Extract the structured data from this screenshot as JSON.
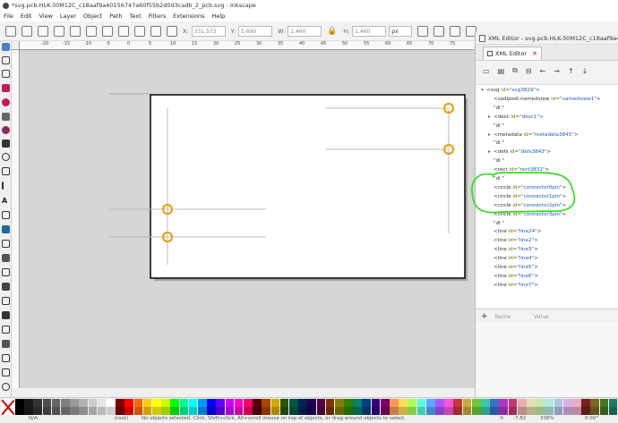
{
  "window": {
    "title": "*svg.pcb.HLK-30M12C_c18aaf9a40156747a60f55b2d0d3cadb_2_pcb.svg - Inkscape"
  },
  "menu": [
    "File",
    "Edit",
    "View",
    "Layer",
    "Object",
    "Path",
    "Text",
    "Filters",
    "Extensions",
    "Help"
  ],
  "tool_controls": {
    "x_label": "X:",
    "x_value": "331.573",
    "y_label": "Y:",
    "y_value": "5.690",
    "w_label": "W:",
    "w_value": "1.460",
    "h_label": "H:",
    "h_value": "1.460",
    "unit": "px"
  },
  "ruler_ticks": [
    "-20",
    "-15",
    "-10",
    "-5",
    "0",
    "5",
    "10",
    "15",
    "20",
    "25",
    "30",
    "35",
    "40",
    "45",
    "50",
    "55",
    "60",
    "65",
    "70",
    "75"
  ],
  "dock": {
    "header": "XML Editor - svg.pcb.HLK-30M12C_c18aaf9a40156747a",
    "tab_label": "XML Editor",
    "toolbar_buttons": [
      "new-element-node",
      "new-text-node",
      "duplicate-node",
      "delete-node",
      "unindent",
      "indent",
      "raise",
      "lower"
    ],
    "tree": [
      {
        "arrow": "▾",
        "prefix": "<",
        "tag": "svg",
        "attr": " id=",
        "val": "\"svg3829\"",
        "suffix": ">"
      },
      {
        "arrow": "",
        "prefix": "<",
        "tag": "sodipodi:namedview",
        "attr": " id=",
        "val": "\"namedview1\"",
        "suffix": ">"
      },
      {
        "arrow": "",
        "prefix": "",
        "tag": "\"dl",
        "attr": "",
        "val": "",
        "suffix": " \""
      },
      {
        "arrow": "▸",
        "prefix": "<",
        "tag": "desc",
        "attr": " id=",
        "val": "\"desc1\"",
        "suffix": ">"
      },
      {
        "arrow": "",
        "prefix": "",
        "tag": "\"dl",
        "attr": "",
        "val": "",
        "suffix": " \""
      },
      {
        "arrow": "▸",
        "prefix": "<",
        "tag": "metadata",
        "attr": " id=",
        "val": "\"metadata3845\"",
        "suffix": ">"
      },
      {
        "arrow": "",
        "prefix": "",
        "tag": "\"dl",
        "attr": "",
        "val": "",
        "suffix": " \""
      },
      {
        "arrow": "▸",
        "prefix": "<",
        "tag": "defs",
        "attr": " id=",
        "val": "\"defs3843\"",
        "suffix": ">"
      },
      {
        "arrow": "",
        "prefix": "",
        "tag": "\"dl",
        "attr": "",
        "val": "",
        "suffix": " \""
      },
      {
        "arrow": "",
        "prefix": "<",
        "tag": "rect",
        "attr": " id=",
        "val": "\"rect3832\"",
        "suffix": ">"
      },
      {
        "arrow": "",
        "prefix": "",
        "tag": "\"dl",
        "attr": "",
        "val": "",
        "suffix": " \""
      },
      {
        "arrow": "",
        "prefix": "<",
        "tag": "circle",
        "attr": " id=",
        "val": "\"connector0pin\"",
        "suffix": ">"
      },
      {
        "arrow": "",
        "prefix": "<",
        "tag": "circle",
        "attr": " id=",
        "val": "\"connector1pin\"",
        "suffix": ">"
      },
      {
        "arrow": "",
        "prefix": "<",
        "tag": "circle",
        "attr": " id=",
        "val": "\"connector2pin\"",
        "suffix": ">"
      },
      {
        "arrow": "",
        "prefix": "<",
        "tag": "circle",
        "attr": " id=",
        "val": "\"connector3pin\"",
        "suffix": ">"
      },
      {
        "arrow": "",
        "prefix": "",
        "tag": "\"dl",
        "attr": "",
        "val": "",
        "suffix": " \""
      },
      {
        "arrow": "",
        "prefix": "<",
        "tag": "line",
        "attr": " id=",
        "val": "\"line24\"",
        "suffix": ">"
      },
      {
        "arrow": "",
        "prefix": "<",
        "tag": "line",
        "attr": " id=",
        "val": "\"line2\"",
        "suffix": ">"
      },
      {
        "arrow": "",
        "prefix": "<",
        "tag": "line",
        "attr": " id=",
        "val": "\"line3\"",
        "suffix": ">"
      },
      {
        "arrow": "",
        "prefix": "<",
        "tag": "line",
        "attr": " id=",
        "val": "\"line4\"",
        "suffix": ">"
      },
      {
        "arrow": "",
        "prefix": "<",
        "tag": "line",
        "attr": " id=",
        "val": "\"line5\"",
        "suffix": ">"
      },
      {
        "arrow": "",
        "prefix": "<",
        "tag": "line",
        "attr": " id=",
        "val": "\"line6\"",
        "suffix": ">"
      },
      {
        "arrow": "",
        "prefix": "<",
        "tag": "line",
        "attr": " id=",
        "val": "\"line7\"",
        "suffix": ">"
      }
    ],
    "attr_headers": {
      "name": "Name",
      "value": "Value"
    }
  },
  "palette_colors": [
    "#000000",
    "#1a1a1a",
    "#333333",
    "#4d4d4d",
    "#666666",
    "#808080",
    "#999999",
    "#b3b3b3",
    "#cccccc",
    "#e6e6e6",
    "#ffffff",
    "#800000",
    "#ff0000",
    "#ff6600",
    "#ffcc00",
    "#ffff00",
    "#ccff00",
    "#00ff00",
    "#00ff99",
    "#00ffff",
    "#0099ff",
    "#0000ff",
    "#6600ff",
    "#cc00ff",
    "#ff00cc",
    "#ff0066",
    "#550000",
    "#aa4400",
    "#d4aa00",
    "#2b5500",
    "#005544",
    "#002255",
    "#220055",
    "#550044",
    "#803300",
    "#808000",
    "#338000",
    "#008066",
    "#004080",
    "#330080",
    "#800066",
    "#ff9955",
    "#ffdd55",
    "#aaff55",
    "#55ffdd",
    "#55aaff",
    "#aa55ff",
    "#ff55dd",
    "#c83737",
    "#c8ab37",
    "#71c837",
    "#37c8ab",
    "#3771c8",
    "#ab37c8",
    "#c83771",
    "#e9afaf",
    "#e9ddaf",
    "#c6e9af",
    "#afe9dd",
    "#afc6e9",
    "#ddafe9",
    "#e9afc6",
    "#782121",
    "#786721",
    "#447821",
    "#217867"
  ],
  "status": {
    "fill_label": "N/A",
    "layer": "(root)",
    "message": "No objects selected. Click, Shift+click, Alt+scroll mouse on top of objects, or drag around objects to select.",
    "x_label": "X:",
    "x_value": "-7.82",
    "zoom": "338%",
    "rotation": "0.00°"
  },
  "annotation": {
    "color": "#33dd22"
  },
  "accent": {
    "connector_color": "#e8a317"
  }
}
